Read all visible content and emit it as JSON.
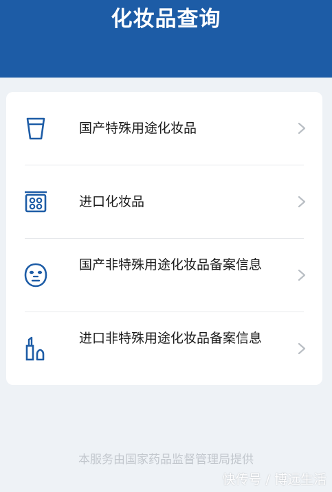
{
  "header": {
    "title": "化妆品查询",
    "color": "#1d5ca6"
  },
  "menu": {
    "items": [
      {
        "label": "国产特殊用途化妆品",
        "icon": "cup-icon"
      },
      {
        "label": "进口化妆品",
        "icon": "compact-palette-icon"
      },
      {
        "label": "国产非特殊用途化妆品备案信息",
        "icon": "face-mask-icon"
      },
      {
        "label": "进口非特殊用途化妆品备案信息",
        "icon": "lipstick-icon"
      }
    ]
  },
  "footer": {
    "text": "本服务由国家药品监督管理局提供"
  },
  "watermark": {
    "text": "快传号 / 博远生活"
  }
}
